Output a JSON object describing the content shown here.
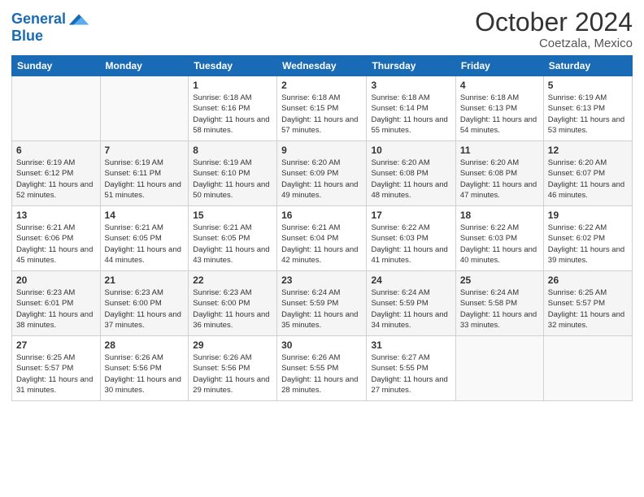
{
  "header": {
    "logo_line1": "General",
    "logo_line2": "Blue",
    "month": "October 2024",
    "location": "Coetzala, Mexico"
  },
  "days_of_week": [
    "Sunday",
    "Monday",
    "Tuesday",
    "Wednesday",
    "Thursday",
    "Friday",
    "Saturday"
  ],
  "weeks": [
    [
      {
        "day": "",
        "sunrise": "",
        "sunset": "",
        "daylight": ""
      },
      {
        "day": "",
        "sunrise": "",
        "sunset": "",
        "daylight": ""
      },
      {
        "day": "1",
        "sunrise": "Sunrise: 6:18 AM",
        "sunset": "Sunset: 6:16 PM",
        "daylight": "Daylight: 11 hours and 58 minutes."
      },
      {
        "day": "2",
        "sunrise": "Sunrise: 6:18 AM",
        "sunset": "Sunset: 6:15 PM",
        "daylight": "Daylight: 11 hours and 57 minutes."
      },
      {
        "day": "3",
        "sunrise": "Sunrise: 6:18 AM",
        "sunset": "Sunset: 6:14 PM",
        "daylight": "Daylight: 11 hours and 55 minutes."
      },
      {
        "day": "4",
        "sunrise": "Sunrise: 6:18 AM",
        "sunset": "Sunset: 6:13 PM",
        "daylight": "Daylight: 11 hours and 54 minutes."
      },
      {
        "day": "5",
        "sunrise": "Sunrise: 6:19 AM",
        "sunset": "Sunset: 6:13 PM",
        "daylight": "Daylight: 11 hours and 53 minutes."
      }
    ],
    [
      {
        "day": "6",
        "sunrise": "Sunrise: 6:19 AM",
        "sunset": "Sunset: 6:12 PM",
        "daylight": "Daylight: 11 hours and 52 minutes."
      },
      {
        "day": "7",
        "sunrise": "Sunrise: 6:19 AM",
        "sunset": "Sunset: 6:11 PM",
        "daylight": "Daylight: 11 hours and 51 minutes."
      },
      {
        "day": "8",
        "sunrise": "Sunrise: 6:19 AM",
        "sunset": "Sunset: 6:10 PM",
        "daylight": "Daylight: 11 hours and 50 minutes."
      },
      {
        "day": "9",
        "sunrise": "Sunrise: 6:20 AM",
        "sunset": "Sunset: 6:09 PM",
        "daylight": "Daylight: 11 hours and 49 minutes."
      },
      {
        "day": "10",
        "sunrise": "Sunrise: 6:20 AM",
        "sunset": "Sunset: 6:08 PM",
        "daylight": "Daylight: 11 hours and 48 minutes."
      },
      {
        "day": "11",
        "sunrise": "Sunrise: 6:20 AM",
        "sunset": "Sunset: 6:08 PM",
        "daylight": "Daylight: 11 hours and 47 minutes."
      },
      {
        "day": "12",
        "sunrise": "Sunrise: 6:20 AM",
        "sunset": "Sunset: 6:07 PM",
        "daylight": "Daylight: 11 hours and 46 minutes."
      }
    ],
    [
      {
        "day": "13",
        "sunrise": "Sunrise: 6:21 AM",
        "sunset": "Sunset: 6:06 PM",
        "daylight": "Daylight: 11 hours and 45 minutes."
      },
      {
        "day": "14",
        "sunrise": "Sunrise: 6:21 AM",
        "sunset": "Sunset: 6:05 PM",
        "daylight": "Daylight: 11 hours and 44 minutes."
      },
      {
        "day": "15",
        "sunrise": "Sunrise: 6:21 AM",
        "sunset": "Sunset: 6:05 PM",
        "daylight": "Daylight: 11 hours and 43 minutes."
      },
      {
        "day": "16",
        "sunrise": "Sunrise: 6:21 AM",
        "sunset": "Sunset: 6:04 PM",
        "daylight": "Daylight: 11 hours and 42 minutes."
      },
      {
        "day": "17",
        "sunrise": "Sunrise: 6:22 AM",
        "sunset": "Sunset: 6:03 PM",
        "daylight": "Daylight: 11 hours and 41 minutes."
      },
      {
        "day": "18",
        "sunrise": "Sunrise: 6:22 AM",
        "sunset": "Sunset: 6:03 PM",
        "daylight": "Daylight: 11 hours and 40 minutes."
      },
      {
        "day": "19",
        "sunrise": "Sunrise: 6:22 AM",
        "sunset": "Sunset: 6:02 PM",
        "daylight": "Daylight: 11 hours and 39 minutes."
      }
    ],
    [
      {
        "day": "20",
        "sunrise": "Sunrise: 6:23 AM",
        "sunset": "Sunset: 6:01 PM",
        "daylight": "Daylight: 11 hours and 38 minutes."
      },
      {
        "day": "21",
        "sunrise": "Sunrise: 6:23 AM",
        "sunset": "Sunset: 6:00 PM",
        "daylight": "Daylight: 11 hours and 37 minutes."
      },
      {
        "day": "22",
        "sunrise": "Sunrise: 6:23 AM",
        "sunset": "Sunset: 6:00 PM",
        "daylight": "Daylight: 11 hours and 36 minutes."
      },
      {
        "day": "23",
        "sunrise": "Sunrise: 6:24 AM",
        "sunset": "Sunset: 5:59 PM",
        "daylight": "Daylight: 11 hours and 35 minutes."
      },
      {
        "day": "24",
        "sunrise": "Sunrise: 6:24 AM",
        "sunset": "Sunset: 5:59 PM",
        "daylight": "Daylight: 11 hours and 34 minutes."
      },
      {
        "day": "25",
        "sunrise": "Sunrise: 6:24 AM",
        "sunset": "Sunset: 5:58 PM",
        "daylight": "Daylight: 11 hours and 33 minutes."
      },
      {
        "day": "26",
        "sunrise": "Sunrise: 6:25 AM",
        "sunset": "Sunset: 5:57 PM",
        "daylight": "Daylight: 11 hours and 32 minutes."
      }
    ],
    [
      {
        "day": "27",
        "sunrise": "Sunrise: 6:25 AM",
        "sunset": "Sunset: 5:57 PM",
        "daylight": "Daylight: 11 hours and 31 minutes."
      },
      {
        "day": "28",
        "sunrise": "Sunrise: 6:26 AM",
        "sunset": "Sunset: 5:56 PM",
        "daylight": "Daylight: 11 hours and 30 minutes."
      },
      {
        "day": "29",
        "sunrise": "Sunrise: 6:26 AM",
        "sunset": "Sunset: 5:56 PM",
        "daylight": "Daylight: 11 hours and 29 minutes."
      },
      {
        "day": "30",
        "sunrise": "Sunrise: 6:26 AM",
        "sunset": "Sunset: 5:55 PM",
        "daylight": "Daylight: 11 hours and 28 minutes."
      },
      {
        "day": "31",
        "sunrise": "Sunrise: 6:27 AM",
        "sunset": "Sunset: 5:55 PM",
        "daylight": "Daylight: 11 hours and 27 minutes."
      },
      {
        "day": "",
        "sunrise": "",
        "sunset": "",
        "daylight": ""
      },
      {
        "day": "",
        "sunrise": "",
        "sunset": "",
        "daylight": ""
      }
    ]
  ]
}
